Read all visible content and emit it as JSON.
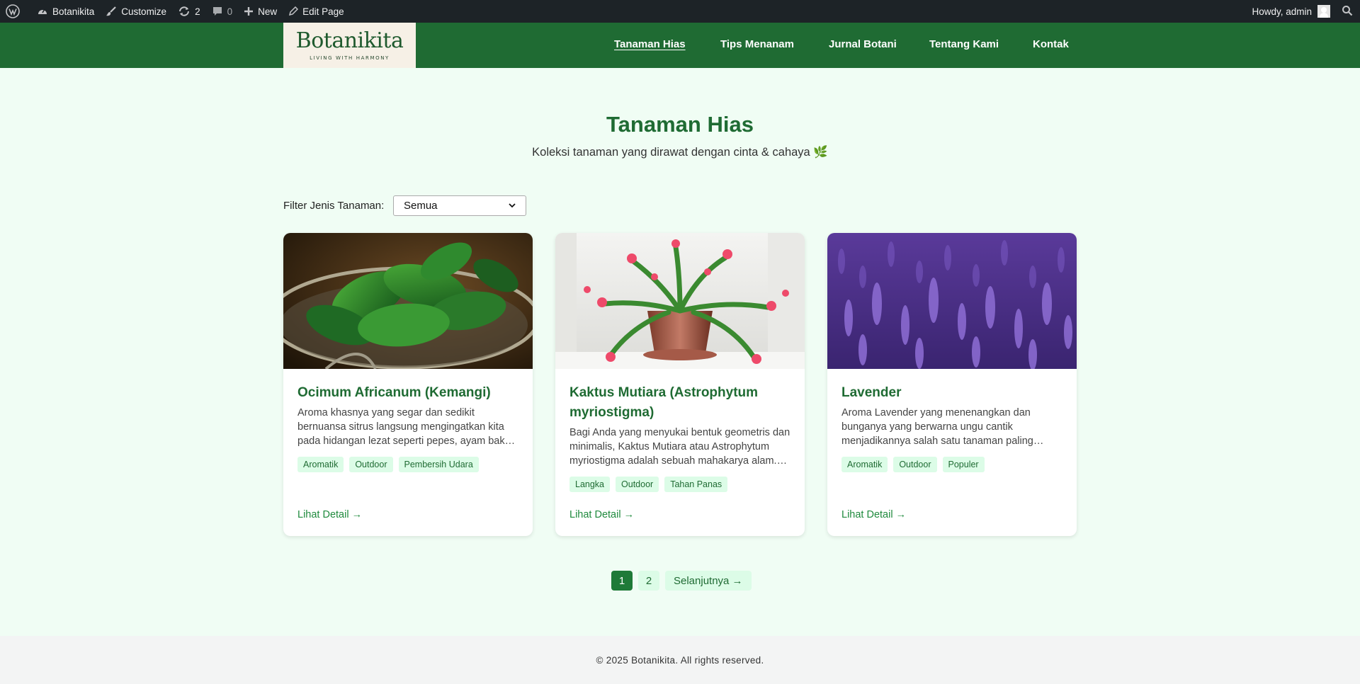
{
  "admin_bar": {
    "site_name": "Botanikita",
    "customize_label": "Customize",
    "updates_count": "2",
    "comments_count": "0",
    "new_label": "New",
    "edit_label": "Edit Page",
    "greeting": "Howdy, admin",
    "icons": [
      "wordpress-icon",
      "dashboard-icon",
      "brush-icon",
      "updates-icon",
      "comment-icon",
      "plus-icon",
      "pencil-icon",
      "search-icon"
    ]
  },
  "header": {
    "logo_word": "Botanikita",
    "logo_tagline": "LIVING WITH HARMONY",
    "nav": [
      "Tanaman Hias",
      "Tips Menanam",
      "Jurnal Botani",
      "Tentang Kami",
      "Kontak"
    ],
    "active_nav": "Tanaman Hias",
    "bg_color": "#1f6b33"
  },
  "page": {
    "title": "Tanaman Hias",
    "subtitle": "Koleksi tanaman yang dirawat dengan cinta & cahaya 🌿"
  },
  "filter": {
    "label": "Filter Jenis Tanaman:",
    "selected": "Semua"
  },
  "cards": [
    {
      "title": "Ocimum Africanum (Kemangi)",
      "description": "Aroma khasnya yang segar dan sedikit bernuansa sitrus langsung mengingatkan kita pada hidangan lezat seperti pepes, ayam bakar, dan lalapan.",
      "tags": [
        "Aromatik",
        "Outdoor",
        "Pembersih Udara"
      ],
      "link": "Lihat Detail →"
    },
    {
      "title": "Kaktus Mutiara (Astrophytum myriostigma)",
      "description": "Bagi Anda yang menyukai bentuk geometris dan minimalis, Kaktus Mutiara atau Astrophytum myriostigma adalah sebuah mahakarya alam. Tanaman",
      "tags": [
        "Langka",
        "Outdoor",
        "Tahan Panas"
      ],
      "link": "Lihat Detail →"
    },
    {
      "title": "Lavender",
      "description": "Aroma Lavender yang menenangkan dan bunganya yang berwarna ungu cantik menjadikannya salah satu tanaman paling populer di dunia.",
      "tags": [
        "Aromatik",
        "Outdoor",
        "Populer"
      ],
      "link": "Lihat Detail →"
    }
  ],
  "pagination": {
    "pages": [
      "1",
      "2"
    ],
    "current": "1",
    "next": "Selanjutnya →"
  },
  "footer": {
    "text": "© 2025 Botanikita. All rights reserved."
  }
}
